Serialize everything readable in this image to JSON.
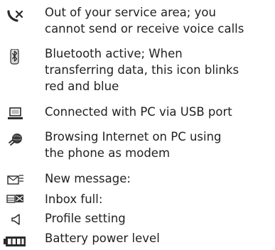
{
  "legend": {
    "items": [
      {
        "icon": "no-service-icon",
        "text": "Out of your service area; you\ncannot send or receive voice calls"
      },
      {
        "icon": "bluetooth-icon",
        "text": "Bluetooth active; When\ntransferring data, this icon blinks\nred and blue"
      },
      {
        "icon": "pc-connection-icon",
        "text": "Connected with PC via USB port"
      },
      {
        "icon": "internet-modem-icon",
        "text": "Browsing Internet on PC using\nthe phone as modem"
      },
      {
        "icon": "new-message-icon",
        "text": "New message:"
      },
      {
        "icon": "inbox-full-icon",
        "text": "Inbox full:"
      },
      {
        "icon": "profile-speaker-icon",
        "text": "Profile setting"
      },
      {
        "icon": "battery-icon",
        "text": "Battery power level"
      }
    ]
  },
  "colors": {
    "text": "#231f20",
    "icon": "#2b2b2b"
  }
}
